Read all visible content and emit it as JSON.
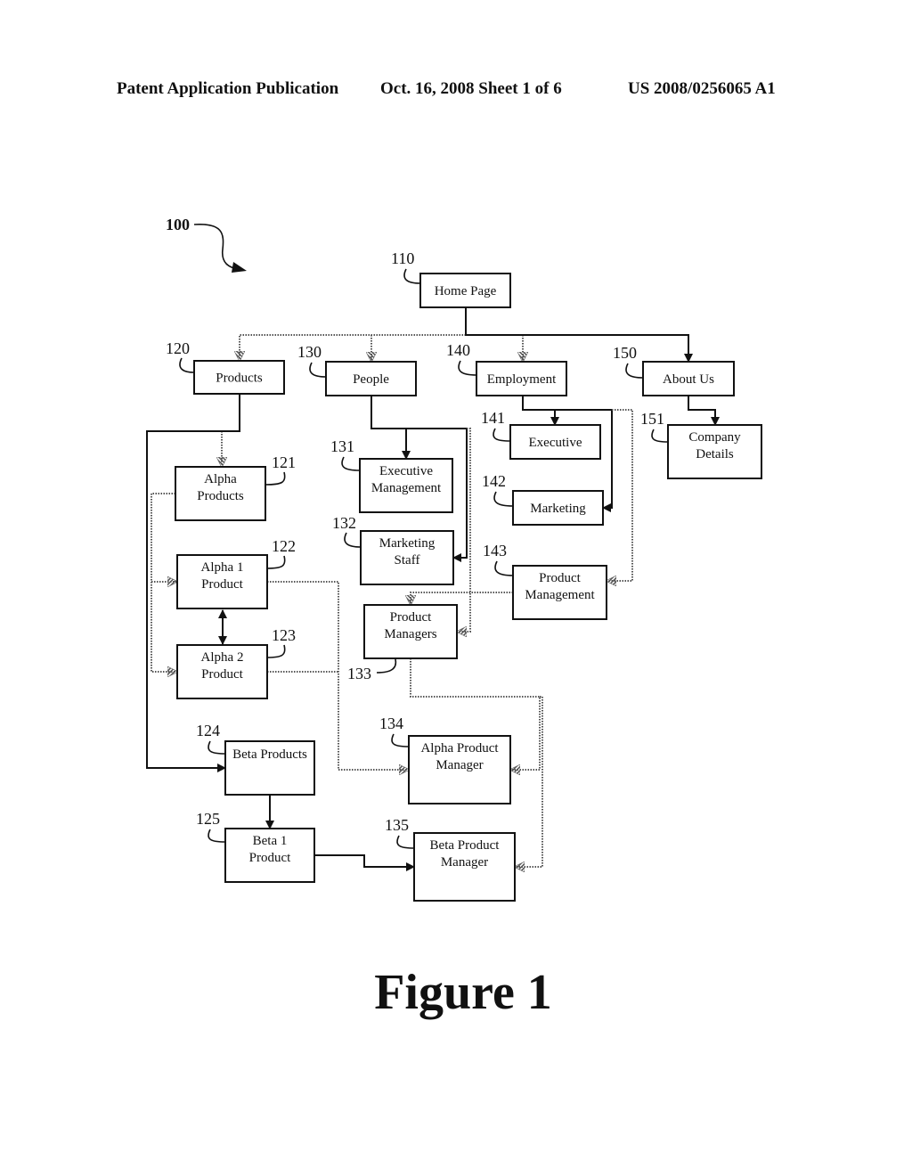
{
  "header": {
    "left": "Patent Application Publication",
    "middle": "Oct. 16, 2008   Sheet 1 of 6",
    "right": "US 2008/0256065 A1"
  },
  "figure": {
    "ref_label": "100",
    "caption": "Figure 1"
  },
  "nodes": [
    {
      "id": "110",
      "lines": [
        "Home Page"
      ]
    },
    {
      "id": "120",
      "lines": [
        "Products"
      ]
    },
    {
      "id": "130",
      "lines": [
        "People"
      ]
    },
    {
      "id": "140",
      "lines": [
        "Employment"
      ]
    },
    {
      "id": "150",
      "lines": [
        "About Us"
      ]
    },
    {
      "id": "121",
      "lines": [
        "Alpha",
        "Products"
      ]
    },
    {
      "id": "122",
      "lines": [
        "Alpha 1",
        "Product"
      ]
    },
    {
      "id": "123",
      "lines": [
        "Alpha 2",
        "Product"
      ]
    },
    {
      "id": "124",
      "lines": [
        "Beta Products"
      ]
    },
    {
      "id": "125",
      "lines": [
        "Beta 1",
        "Product"
      ]
    },
    {
      "id": "131",
      "lines": [
        "Executive",
        "Management"
      ]
    },
    {
      "id": "132",
      "lines": [
        "Marketing",
        "Staff"
      ]
    },
    {
      "id": "133",
      "lines": [
        "Product",
        "Managers"
      ]
    },
    {
      "id": "134",
      "lines": [
        "Alpha Product",
        "Manager"
      ]
    },
    {
      "id": "135",
      "lines": [
        "Beta Product",
        "Manager"
      ]
    },
    {
      "id": "141",
      "lines": [
        "Executive"
      ]
    },
    {
      "id": "142",
      "lines": [
        "Marketing"
      ]
    },
    {
      "id": "143",
      "lines": [
        "Product",
        "Management"
      ]
    },
    {
      "id": "151",
      "lines": [
        "Company",
        "Details"
      ]
    }
  ],
  "edges": [
    {
      "from": "110",
      "to": "120",
      "style": "dotted"
    },
    {
      "from": "110",
      "to": "130",
      "style": "dotted"
    },
    {
      "from": "110",
      "to": "140",
      "style": "dotted"
    },
    {
      "from": "110",
      "to": "150",
      "style": "solid"
    },
    {
      "from": "120",
      "to": "121",
      "style": "dotted"
    },
    {
      "from": "120",
      "to": "124",
      "style": "solid"
    },
    {
      "from": "121",
      "to": "122",
      "style": "dotted"
    },
    {
      "from": "121",
      "to": "123",
      "style": "dotted"
    },
    {
      "from": "122",
      "to": "123",
      "style": "solid-bidirectional"
    },
    {
      "from": "122",
      "to": "134",
      "style": "dotted"
    },
    {
      "from": "123",
      "to": "134",
      "style": "dotted"
    },
    {
      "from": "124",
      "to": "125",
      "style": "solid"
    },
    {
      "from": "125",
      "to": "135",
      "style": "solid"
    },
    {
      "from": "130",
      "to": "131",
      "style": "solid"
    },
    {
      "from": "130",
      "to": "132",
      "style": "solid"
    },
    {
      "from": "130",
      "to": "133",
      "style": "dotted"
    },
    {
      "from": "133",
      "to": "134",
      "style": "dotted"
    },
    {
      "from": "133",
      "to": "135",
      "style": "dotted"
    },
    {
      "from": "140",
      "to": "141",
      "style": "solid"
    },
    {
      "from": "140",
      "to": "142",
      "style": "solid"
    },
    {
      "from": "140",
      "to": "143",
      "style": "dotted"
    },
    {
      "from": "143",
      "to": "133",
      "style": "dotted"
    },
    {
      "from": "150",
      "to": "151",
      "style": "solid"
    }
  ]
}
